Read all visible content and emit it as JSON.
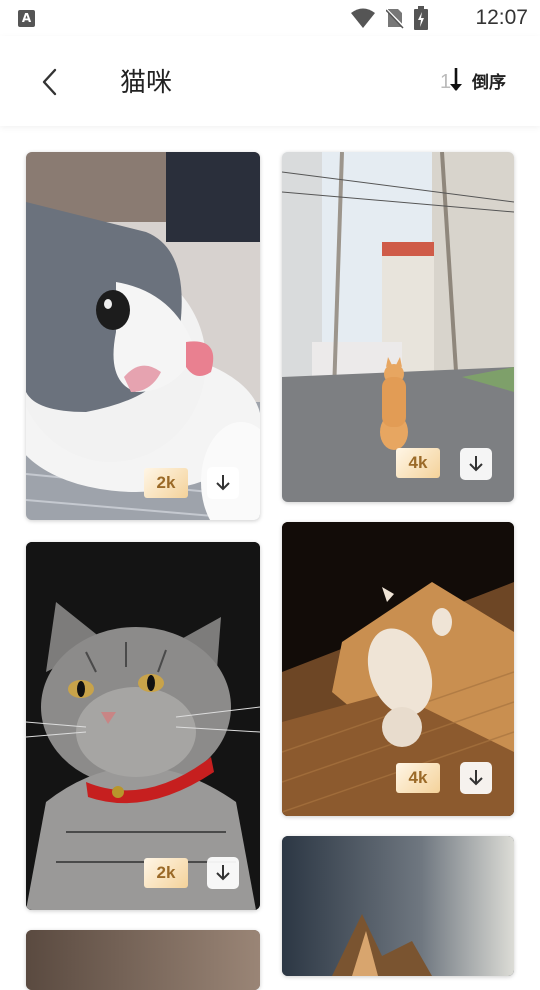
{
  "status_bar": {
    "time": "12:07"
  },
  "header": {
    "title": "猫咪",
    "sort_label": "倒序"
  },
  "colors": {
    "badge_text": "#9b6a28",
    "badge_bg_start": "#fff6e6",
    "badge_bg_end": "#f4d29a"
  },
  "cards": [
    {
      "resolution": "2k",
      "icon": "download-icon"
    },
    {
      "resolution": "4k",
      "icon": "download-icon"
    },
    {
      "resolution": "2k",
      "icon": "download-icon"
    },
    {
      "resolution": "4k",
      "icon": "download-icon"
    }
  ]
}
